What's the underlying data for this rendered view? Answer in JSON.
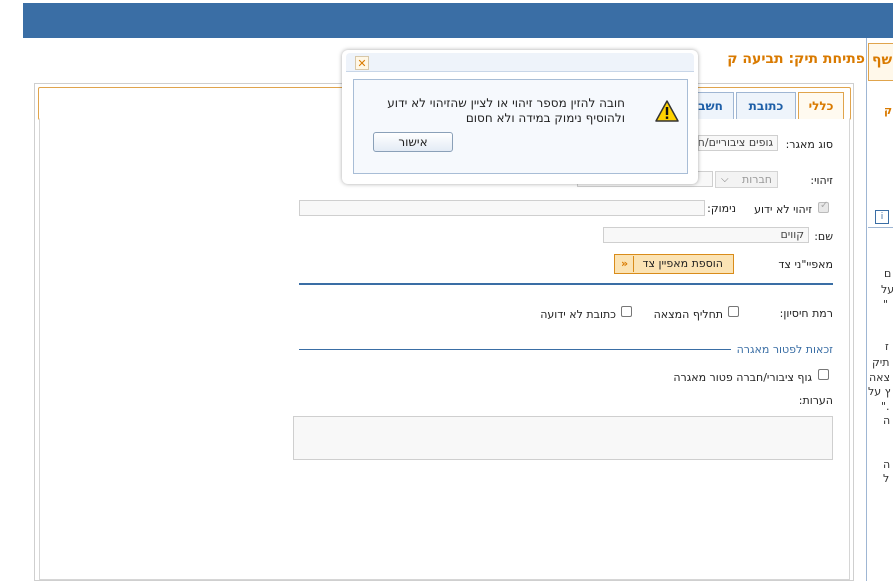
{
  "page": {
    "title": "פתיחת תיק: תביעה ק",
    "right_panel_header": "שף:",
    "right_panel_fragments": [
      "ק",
      "ם",
      "על",
      "\"",
      "ז",
      "תיק",
      "צאה",
      "ץ על",
      "\".",
      "ה",
      "ה",
      "ל"
    ],
    "right_panel_icon": "i"
  },
  "tabs": [
    {
      "label": "כללי",
      "active": true
    },
    {
      "label": "כתובת",
      "active": false
    },
    {
      "label": "חשב",
      "active": false
    }
  ],
  "form": {
    "source_type_label": "סוג מאגר:",
    "source_type_value": "גופים ציבוריים/ח",
    "id_label": "זיהוי:",
    "id_type_value": "חברות",
    "id_unknown_label": "זיהוי לא ידוע",
    "reason_label": "נימוק:",
    "name_label": "שם:",
    "name_value": "קווים",
    "characteristic_label": "מאפיי\"ני צד",
    "add_characteristic_button": "הוספת מאפיין צד",
    "secrecy_label": "רמת חיסיון:",
    "alias_checkbox": "תחליף המצאה",
    "unknown_address_checkbox": "כתובת לא ידועה",
    "exemption_section_title": "זכאות לפטור מאגרה",
    "exempt_body_checkbox": "גוף ציבורי/חברה פטור מאגרה",
    "notes_label": "הערות:"
  },
  "modal": {
    "message_line1": "חובה להזין מספר זיהוי או לציין שהזיהוי לא ידוע",
    "message_line2": "ולהוסיף נימוק במידה ולא חסום",
    "ok_button": "אישור",
    "close_icon": "close-icon",
    "warning_icon": "warning-icon"
  },
  "colors": {
    "header_blue": "#3a6ea5",
    "accent_orange": "#d97a00"
  }
}
